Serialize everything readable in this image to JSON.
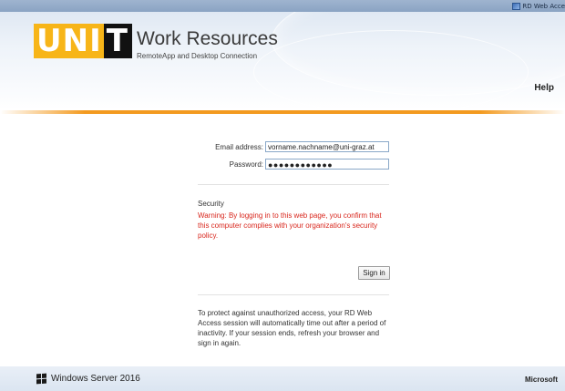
{
  "topbar": {
    "app_label": "RD Web Acce"
  },
  "header": {
    "logo_part1": "UNI",
    "logo_part2": "T",
    "title": "Work Resources",
    "subtitle": "RemoteApp and Desktop Connection",
    "help_link": "Help"
  },
  "login": {
    "email_label": "Email address:",
    "email_value": "vorname.nachname@uni-graz.at",
    "password_label": "Password:",
    "password_value": "●●●●●●●●●●●●",
    "security_title": "Security",
    "security_warning": "Warning: By logging in to this web page, you confirm that this computer complies with your organization's security policy.",
    "sign_in_button": "Sign in",
    "timeout_notice": "To protect against unauthorized access, your RD Web Access session will automatically time out after a period of inactivity. If your session ends, refresh your browser and sign in again."
  },
  "footer": {
    "os_label": "Windows Server 2016",
    "vendor_label": "Microsoft"
  },
  "colors": {
    "accent_orange": "#f39a1f",
    "logo_yellow": "#f7b518",
    "warning_red": "#d8261c"
  }
}
